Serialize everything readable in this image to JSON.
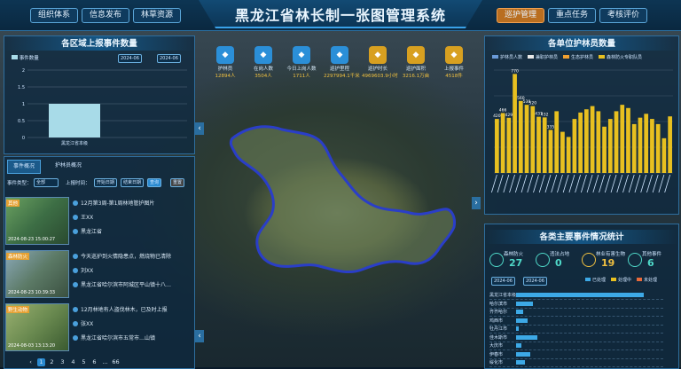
{
  "app": {
    "title": "黑龙江省林长制一张图管理系统"
  },
  "nav_left": [
    "组织体系",
    "信息发布",
    "林草资源"
  ],
  "nav_right": [
    {
      "label": "巡护管理",
      "active": true
    },
    {
      "label": "重点任务",
      "active": false
    },
    {
      "label": "考核评价",
      "active": false
    }
  ],
  "left_chart": {
    "title": "各区域上报事件数量",
    "legend": "事件数量",
    "selector1": "2024-06",
    "selector2": "2024-06",
    "chart_data": {
      "type": "bar",
      "categories": [
        "黑龙江省本级"
      ],
      "values": [
        1
      ],
      "xlabel": "",
      "ylabel": "",
      "ylim": [
        0,
        2
      ],
      "yticks": [
        "0",
        "0.5",
        "1",
        "1.5",
        "2"
      ]
    }
  },
  "stats": [
    {
      "label": "护林员",
      "value": "12894人",
      "color": "#2b8fd8"
    },
    {
      "label": "在岗人数",
      "value": "3504人",
      "color": "#2b8fd8"
    },
    {
      "label": "今日上岗人数",
      "value": "1711人",
      "color": "#2b8fd8"
    },
    {
      "label": "巡护里程",
      "value": "2297994.1千米",
      "color": "#2b8fd8"
    },
    {
      "label": "巡护时长",
      "value": "4969603.9小时",
      "color": "#d8a020"
    },
    {
      "label": "巡护面积",
      "value": "3216.1万亩",
      "color": "#d8a020"
    },
    {
      "label": "上报事件",
      "value": "4518件",
      "color": "#d8a020"
    }
  ],
  "event_panel": {
    "tabs": [
      "事件概况",
      "护林员概况"
    ],
    "filter_type_label": "事件类型：",
    "filter_type_value": "全部",
    "filter_time_label": "上报时间：",
    "date_from": "开始日期",
    "date_to": "结束日期",
    "search_label": "查询",
    "reset_label": "重置",
    "items": [
      {
        "tag": "其他",
        "time": "2024-08-23 15:00:27",
        "title": "12月第3周-第1周林地管护图片",
        "person": "王XX",
        "place": "黑龙江省"
      },
      {
        "tag": "森林防火",
        "time": "2024-08-23 10:39:33",
        "title": "今天巡护到火情隐患点，燃烧物已清除",
        "person": "刘XX",
        "place": "黑龙江省哈尔滨市阿城区平山镇十八…"
      },
      {
        "tag": "野生动物",
        "time": "2024-08-03 13:13:20",
        "title": "12月林地有人盗伐林木，已及时上报",
        "person": "张XX",
        "place": "黑龙江省哈尔滨市五常市…山镇"
      }
    ],
    "pages": [
      "1",
      "2",
      "3",
      "4",
      "5",
      "6",
      "...",
      "66"
    ],
    "current_page": "1"
  },
  "right_chart": {
    "title": "各单位护林员数量",
    "legend": [
      "护林员人数",
      "兼职护林员",
      "生态护林员",
      "森林防火专职队员"
    ],
    "chart_data": {
      "type": "bar",
      "categories": [
        "A",
        "B",
        "C",
        "D",
        "E",
        "F",
        "G",
        "H",
        "I",
        "J",
        "K",
        "L",
        "M",
        "N",
        "O",
        "P",
        "Q",
        "R",
        "S",
        "T",
        "U",
        "V",
        "W",
        "X",
        "Y",
        "Z",
        "AA",
        "AB",
        "AC",
        "AD"
      ],
      "series": [
        {
          "name": "护林员人数",
          "values": [
            420,
            466,
            429,
            770,
            560,
            530,
            520,
            437,
            432,
            335,
            480,
            320,
            280,
            420,
            470,
            495,
            520,
            480,
            360,
            420,
            480,
            530,
            505,
            380,
            430,
            460,
            420,
            380,
            270,
            440
          ]
        }
      ],
      "ylim": [
        0,
        800
      ],
      "labels_shown": [
        "420",
        "466",
        "429",
        "770",
        "560",
        "530",
        "520",
        "437",
        "432",
        "335"
      ],
      "xlabel": "",
      "ylabel": ""
    }
  },
  "right_stats": {
    "title": "各类主要事件情况统计",
    "kpis": [
      {
        "label": "森林防火",
        "value": "27",
        "color": "#4fd8c8"
      },
      {
        "label": "违法占地",
        "value": "0",
        "color": "#4fd8c8"
      },
      {
        "label": "林业有害生物",
        "value": "19",
        "color": "#f0c040"
      },
      {
        "label": "其他事件",
        "value": "6",
        "color": "#4fd8c8"
      }
    ],
    "filter1": "2024-06",
    "filter2": "2024-06",
    "legend": [
      "已处理",
      "处理中",
      "未处理"
    ],
    "rows": [
      {
        "name": "黑龙江省本级",
        "v": 0.9
      },
      {
        "name": "哈尔滨市",
        "v": 0.12
      },
      {
        "name": "齐齐哈尔",
        "v": 0.05
      },
      {
        "name": "鸡西市",
        "v": 0.08
      },
      {
        "name": "牡丹江市",
        "v": 0.02
      },
      {
        "name": "佳木斯市",
        "v": 0.15
      },
      {
        "name": "大庆市",
        "v": 0.04
      },
      {
        "name": "伊春市",
        "v": 0.1
      },
      {
        "name": "绥化市",
        "v": 0.06
      }
    ]
  }
}
